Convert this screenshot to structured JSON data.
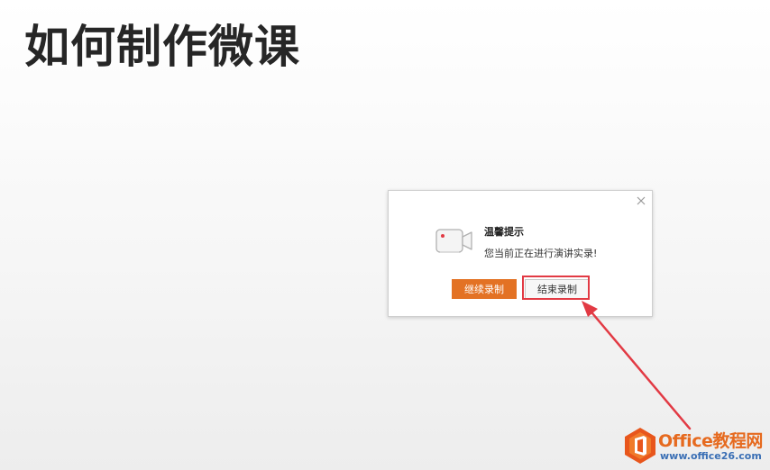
{
  "slide": {
    "title": "如何制作微课"
  },
  "dialog": {
    "title": "温馨提示",
    "message": "您当前正在进行演讲实录!",
    "continue_label": "继续录制",
    "end_label": "结束录制",
    "icon": "video-camera-icon",
    "close_icon": "close-icon"
  },
  "watermark": {
    "main": "Office教程网",
    "url": "www.office26.com"
  },
  "colors": {
    "accent": "#e37224",
    "highlight": "#e23a44",
    "watermark_orange": "#e66a1f",
    "watermark_blue": "#3a6fb5"
  }
}
